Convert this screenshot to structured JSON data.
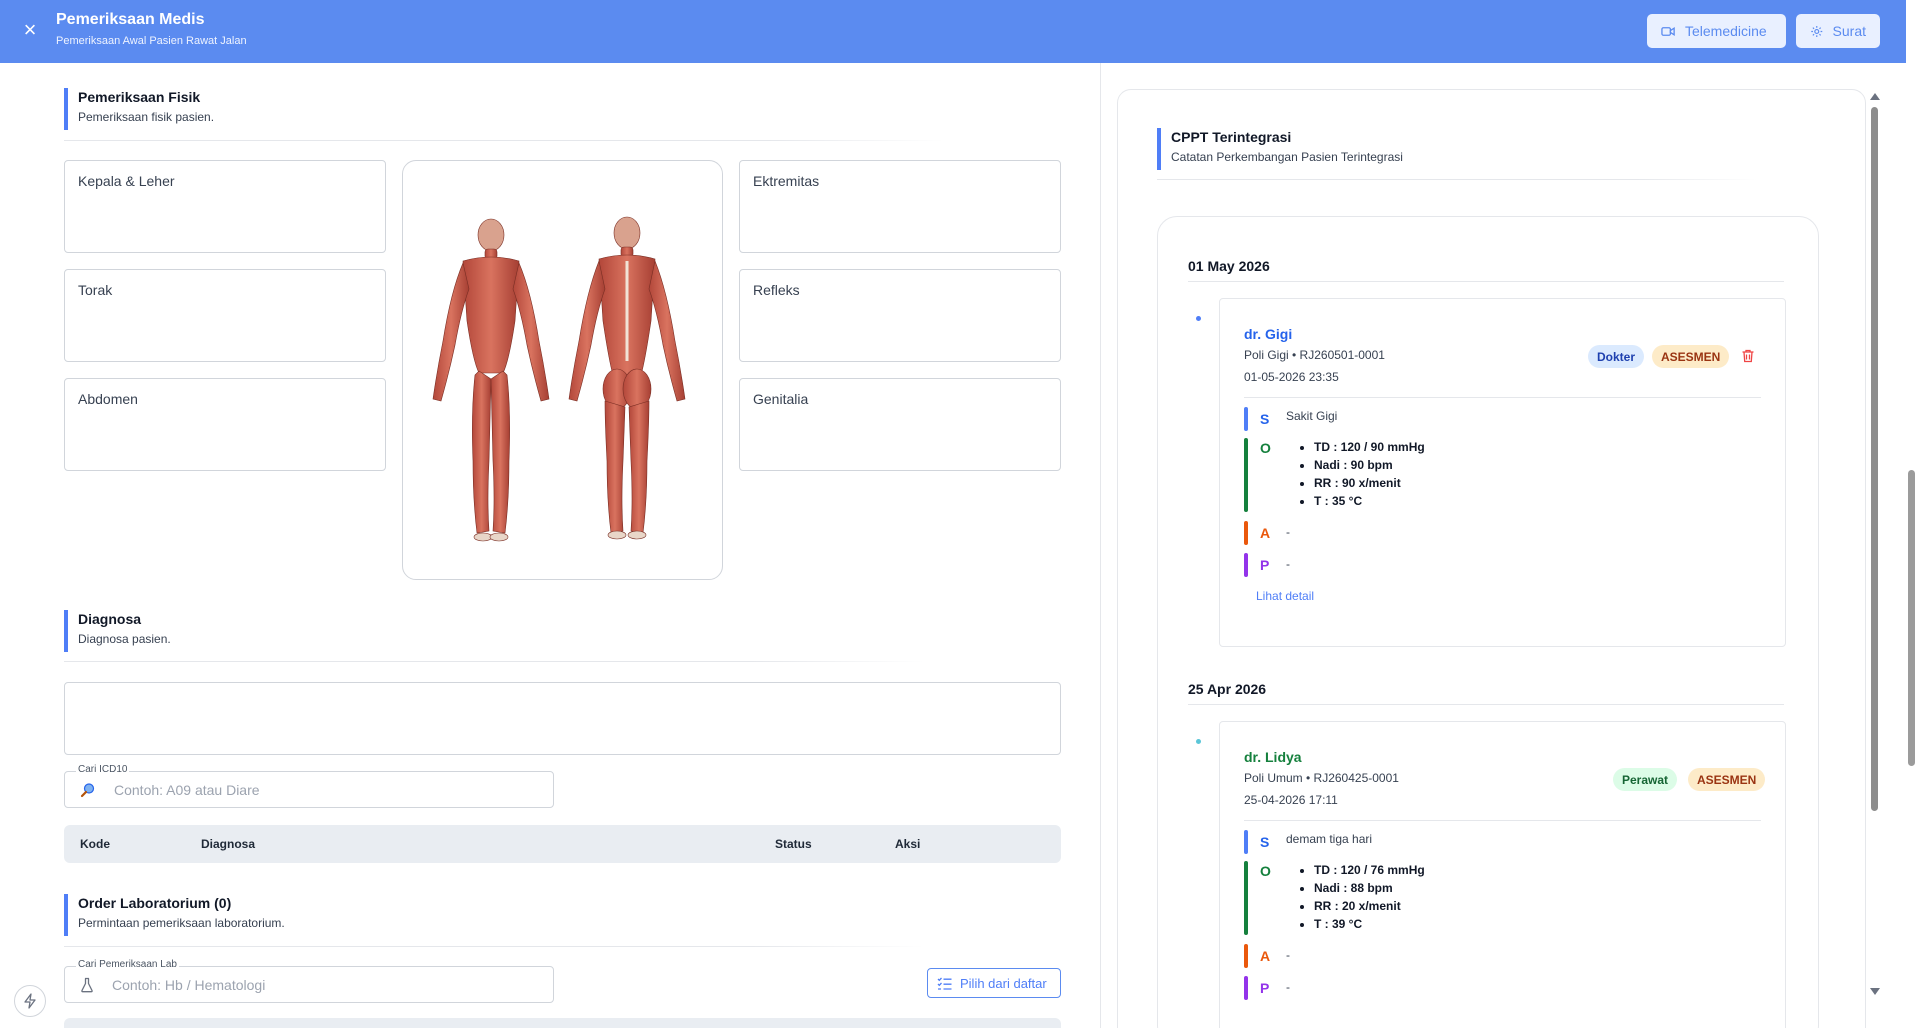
{
  "header": {
    "title": "Pemeriksaan Medis",
    "subtitle": "Pemeriksaan Awal Pasien Rawat Jalan",
    "telemedicine_label": "Telemedicine",
    "surat_label": "Surat",
    "close_glyph": "×"
  },
  "pemeriksaan_fisik": {
    "title": "Pemeriksaan Fisik",
    "subtitle": "Pemeriksaan fisik pasien.",
    "fields": {
      "kepala_leher": "Kepala & Leher",
      "torak": "Torak",
      "abdomen": "Abdomen",
      "ektremitas": "Ektremitas",
      "refleks": "Refleks",
      "genitalia": "Genitalia"
    }
  },
  "diagnosa": {
    "title": "Diagnosa",
    "subtitle": "Diagnosa pasien.",
    "search_label": "Cari ICD10",
    "search_placeholder": "Contoh: A09 atau Diare",
    "columns": [
      "Kode",
      "Diagnosa",
      "Status",
      "Aksi"
    ]
  },
  "order_lab": {
    "title": "Order Laboratorium (0)",
    "subtitle": "Permintaan pemeriksaan laboratorium.",
    "search_label": "Cari Pemeriksaan Lab",
    "search_placeholder": "Contoh: Hb / Hematologi",
    "pick_button": "Pilih dari daftar"
  },
  "cppt": {
    "title": "CPPT Terintegrasi",
    "subtitle": "Catatan Perkembangan Pasien Terintegrasi",
    "groups": [
      {
        "date": "01 May 2026",
        "entry": {
          "doctor": "dr. Gigi",
          "meta": "Poli Gigi • RJ260501-0001",
          "time": "01-05-2026 23:35",
          "role_badge": "Dokter",
          "type_badge": "ASESMEN",
          "s": "Sakit Gigi",
          "o": [
            "TD : 120 / 90 mmHg",
            "Nadi : 90 bpm",
            "RR : 90 x/menit",
            "T : 35 °C"
          ],
          "a": "-",
          "p": "-",
          "detail_link": "Lihat detail"
        }
      },
      {
        "date": "25 Apr 2026",
        "entry": {
          "doctor": "dr. Lidya",
          "meta": "Poli Umum • RJ260425-0001",
          "time": "25-04-2026 17:11",
          "role_badge": "Perawat",
          "type_badge": "ASESMEN",
          "s": "demam tiga hari",
          "o": [
            "TD : 120 / 76 mmHg",
            "Nadi : 88 bpm",
            "RR : 20 x/menit",
            "T : 39 °C"
          ],
          "a": "-",
          "p": "-"
        }
      }
    ],
    "soap_letters": {
      "s": "S",
      "o": "O",
      "a": "A",
      "p": "P"
    }
  },
  "colors": {
    "header": "#5b8bf0",
    "accent": "#4f7ef7",
    "doctor_link": "#2563eb",
    "nurse_link": "#15803d",
    "badge_dokter_bg": "#dbeafe",
    "badge_perawat_bg": "#dcfce7",
    "badge_asesmen_bg": "#fdebc8",
    "soap_s": "#2563eb",
    "soap_o": "#15803d",
    "soap_a": "#ea580c",
    "soap_p": "#9333ea"
  }
}
